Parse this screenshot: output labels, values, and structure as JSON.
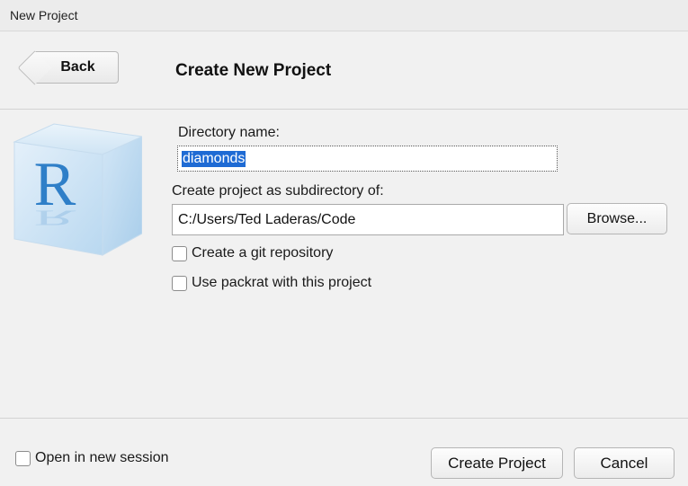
{
  "window": {
    "title": "New Project"
  },
  "header": {
    "back_label": "Back",
    "title": "Create New Project"
  },
  "form": {
    "directory_label": "Directory name:",
    "directory_value": "diamonds",
    "subdir_label": "Create project as subdirectory of:",
    "subdir_value": "C:/Users/Ted Laderas/Code",
    "browse_label": "Browse...",
    "git_label": "Create a git repository",
    "git_checked": false,
    "packrat_label": "Use packrat with this project",
    "packrat_checked": false
  },
  "logo": {
    "letter": "R"
  },
  "footer": {
    "new_session_label": "Open in new session",
    "new_session_checked": false,
    "create_label": "Create Project",
    "cancel_label": "Cancel"
  },
  "colors": {
    "selection": "#1f6bd4",
    "r_blue": "#2f7fc8"
  }
}
